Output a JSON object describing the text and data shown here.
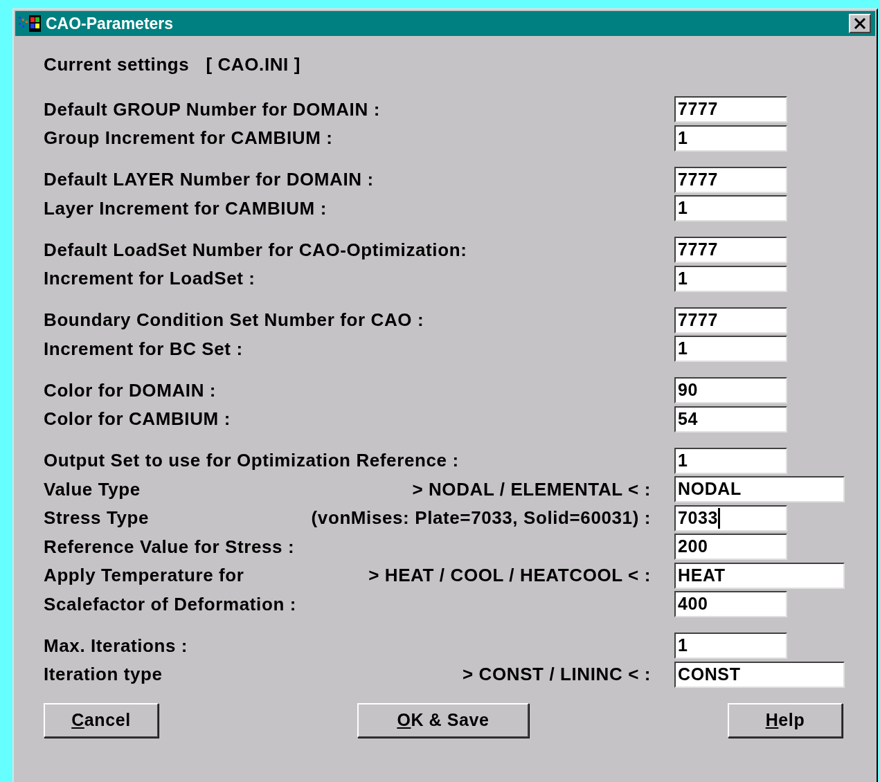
{
  "window": {
    "title": "CAO-Parameters"
  },
  "current_settings": {
    "label": "Current settings",
    "file": "[ CAO.INI ]"
  },
  "groups": [
    {
      "rows": [
        {
          "label": "Default GROUP Number for DOMAIN :",
          "value": "7777",
          "wide": false,
          "focused": false
        },
        {
          "label": "Group Increment for CAMBIUM :",
          "value": "1",
          "wide": false,
          "focused": false
        }
      ]
    },
    {
      "rows": [
        {
          "label": "Default LAYER Number for DOMAIN :",
          "value": "7777",
          "wide": false,
          "focused": false
        },
        {
          "label": "Layer Increment for CAMBIUM :",
          "value": "1",
          "wide": false,
          "focused": false
        }
      ]
    },
    {
      "rows": [
        {
          "label": "Default LoadSet Number for CAO-Optimization:",
          "value": "7777",
          "wide": false,
          "focused": false
        },
        {
          "label": "Increment for LoadSet :",
          "value": "1",
          "wide": false,
          "focused": false
        }
      ]
    },
    {
      "rows": [
        {
          "label": "Boundary Condition Set Number for CAO :",
          "value": "7777",
          "wide": false,
          "focused": false
        },
        {
          "label": "Increment for BC Set :",
          "value": "1",
          "wide": false,
          "focused": false
        }
      ]
    },
    {
      "rows": [
        {
          "label": "Color for DOMAIN :",
          "value": "90",
          "wide": false,
          "focused": false
        },
        {
          "label": "Color for CAMBIUM :",
          "value": "54",
          "wide": false,
          "focused": false
        }
      ]
    },
    {
      "rows": [
        {
          "label": "Output Set to use for Optimization Reference :",
          "value": "1",
          "wide": false,
          "focused": false
        },
        {
          "label": "Value Type",
          "hint": "> NODAL / ELEMENTAL < :",
          "value": "NODAL",
          "wide": true,
          "focused": false
        },
        {
          "label": "Stress Type",
          "hint": "(vonMises: Plate=7033, Solid=60031) :",
          "value": "7033",
          "wide": false,
          "focused": true
        },
        {
          "label": "Reference Value for Stress :",
          "value": "200",
          "wide": false,
          "focused": false
        },
        {
          "label": "Apply Temperature for",
          "hint": "> HEAT / COOL / HEATCOOL < :",
          "value": "HEAT",
          "wide": true,
          "focused": false
        },
        {
          "label": "Scalefactor of Deformation :",
          "value": "400",
          "wide": false,
          "focused": false
        }
      ]
    },
    {
      "rows": [
        {
          "label": "Max. Iterations :",
          "value": "1",
          "wide": false,
          "focused": false
        },
        {
          "label": "Iteration type",
          "hint": "> CONST / LININC < :",
          "value": "CONST",
          "wide": true,
          "focused": false
        }
      ]
    }
  ],
  "buttons": [
    {
      "access_key": "C",
      "rest": "ancel"
    },
    {
      "access_key": "O",
      "rest": "K & Save"
    },
    {
      "access_key": "H",
      "rest": "elp"
    }
  ]
}
